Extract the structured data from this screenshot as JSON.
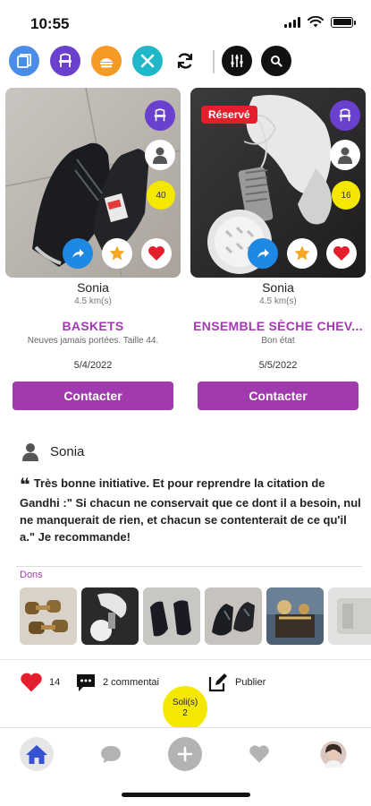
{
  "status": {
    "time": "10:55"
  },
  "toolbar": {
    "icons": [
      "books-icon",
      "chair-icon",
      "food-icon",
      "tools-icon",
      "refresh-icon",
      "filter-icon",
      "search-icon"
    ]
  },
  "cards": [
    {
      "owner": "Sonia",
      "distance": "4.5 km(s)",
      "title": "BASKETS",
      "subtitle": "Neuves jamais portées. Taille 44.",
      "date": "5/4/2022",
      "count": "40",
      "contact_label": "Contacter",
      "reserved_label": ""
    },
    {
      "owner": "Sonia",
      "distance": "4.5 km(s)",
      "title": "ENSEMBLE SÈCHE CHEV...",
      "subtitle": "Bon état",
      "date": "5/5/2022",
      "count": "16",
      "contact_label": "Contacter",
      "reserved_label": "Réservé"
    }
  ],
  "review": {
    "author": "Sonia",
    "text": "Très bonne initiative. Et pour reprendre la citation de Gandhi :\" Si chacun ne conservait que ce dont il a besoin, nul ne manquerait de rien, et chacun se contenterait de ce qu'il a.\" Je recommande!",
    "dons_label": "Dons"
  },
  "actions": {
    "likes": "14",
    "comments": "2 commentai",
    "publish": "Publier",
    "sold_line1": "Soli(s)",
    "sold_line2": "2"
  },
  "colors": {
    "accent": "#a23aaf",
    "category": "#6a41ce",
    "heart": "#e41e2c",
    "badge_yellow": "#f5e800",
    "share_blue": "#1e88e5",
    "star": "#f5a623"
  }
}
